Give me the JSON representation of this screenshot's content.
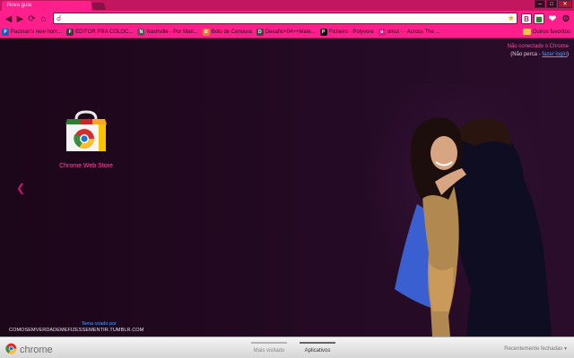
{
  "tab": {
    "title": "Nova guia"
  },
  "window": {
    "controls": [
      "–",
      "□",
      "✕"
    ]
  },
  "toolbar": {
    "back_icon": "back-arrow-icon",
    "forward_icon": "forward-arrow-icon",
    "home_icon": "home-icon",
    "omnibox_value": ""
  },
  "bookmarks": {
    "items": [
      {
        "label": "Pacman's new hom...",
        "icon": "P",
        "color": "#1a5fb4"
      },
      {
        "label": "EDITOR PRA COLOC...",
        "icon": "F",
        "color": "#3a3a3a"
      },
      {
        "label": "Nashville - Por Mari...",
        "icon": "N",
        "color": "#555555"
      },
      {
        "label": "Bolo de Cenoura",
        "icon": "B",
        "color": "#e67e22"
      },
      {
        "label": "Desafio+04++Mate...",
        "icon": "D",
        "color": "#444444"
      },
      {
        "label": "Ficheiro - Polyvore",
        "icon": "P",
        "color": "#111111"
      },
      {
        "label": "orkut - - Across The ...",
        "icon": "o",
        "color": "#d81b80"
      }
    ],
    "other_label": "Outros favoritos"
  },
  "signin": {
    "line1": "Não conectado o Chrome",
    "line2_prefix": "(Não perca - ",
    "line2_link": "fazer login",
    "line2_suffix": ")"
  },
  "apps": [
    {
      "label": "Chrome Web Store",
      "icon": "chrome-web-store-icon"
    }
  ],
  "theme_credit": {
    "line1": "Tema criado por",
    "line2": "COMOSEMVERDADEMEFIZESSEMENTIR.TUMBLR.COM"
  },
  "footer": {
    "logo_text": "chrome",
    "tabs": [
      {
        "label": "Mais visitado"
      },
      {
        "label": "Aplicativos"
      }
    ],
    "recent_label": "Recentemente fechadas"
  }
}
